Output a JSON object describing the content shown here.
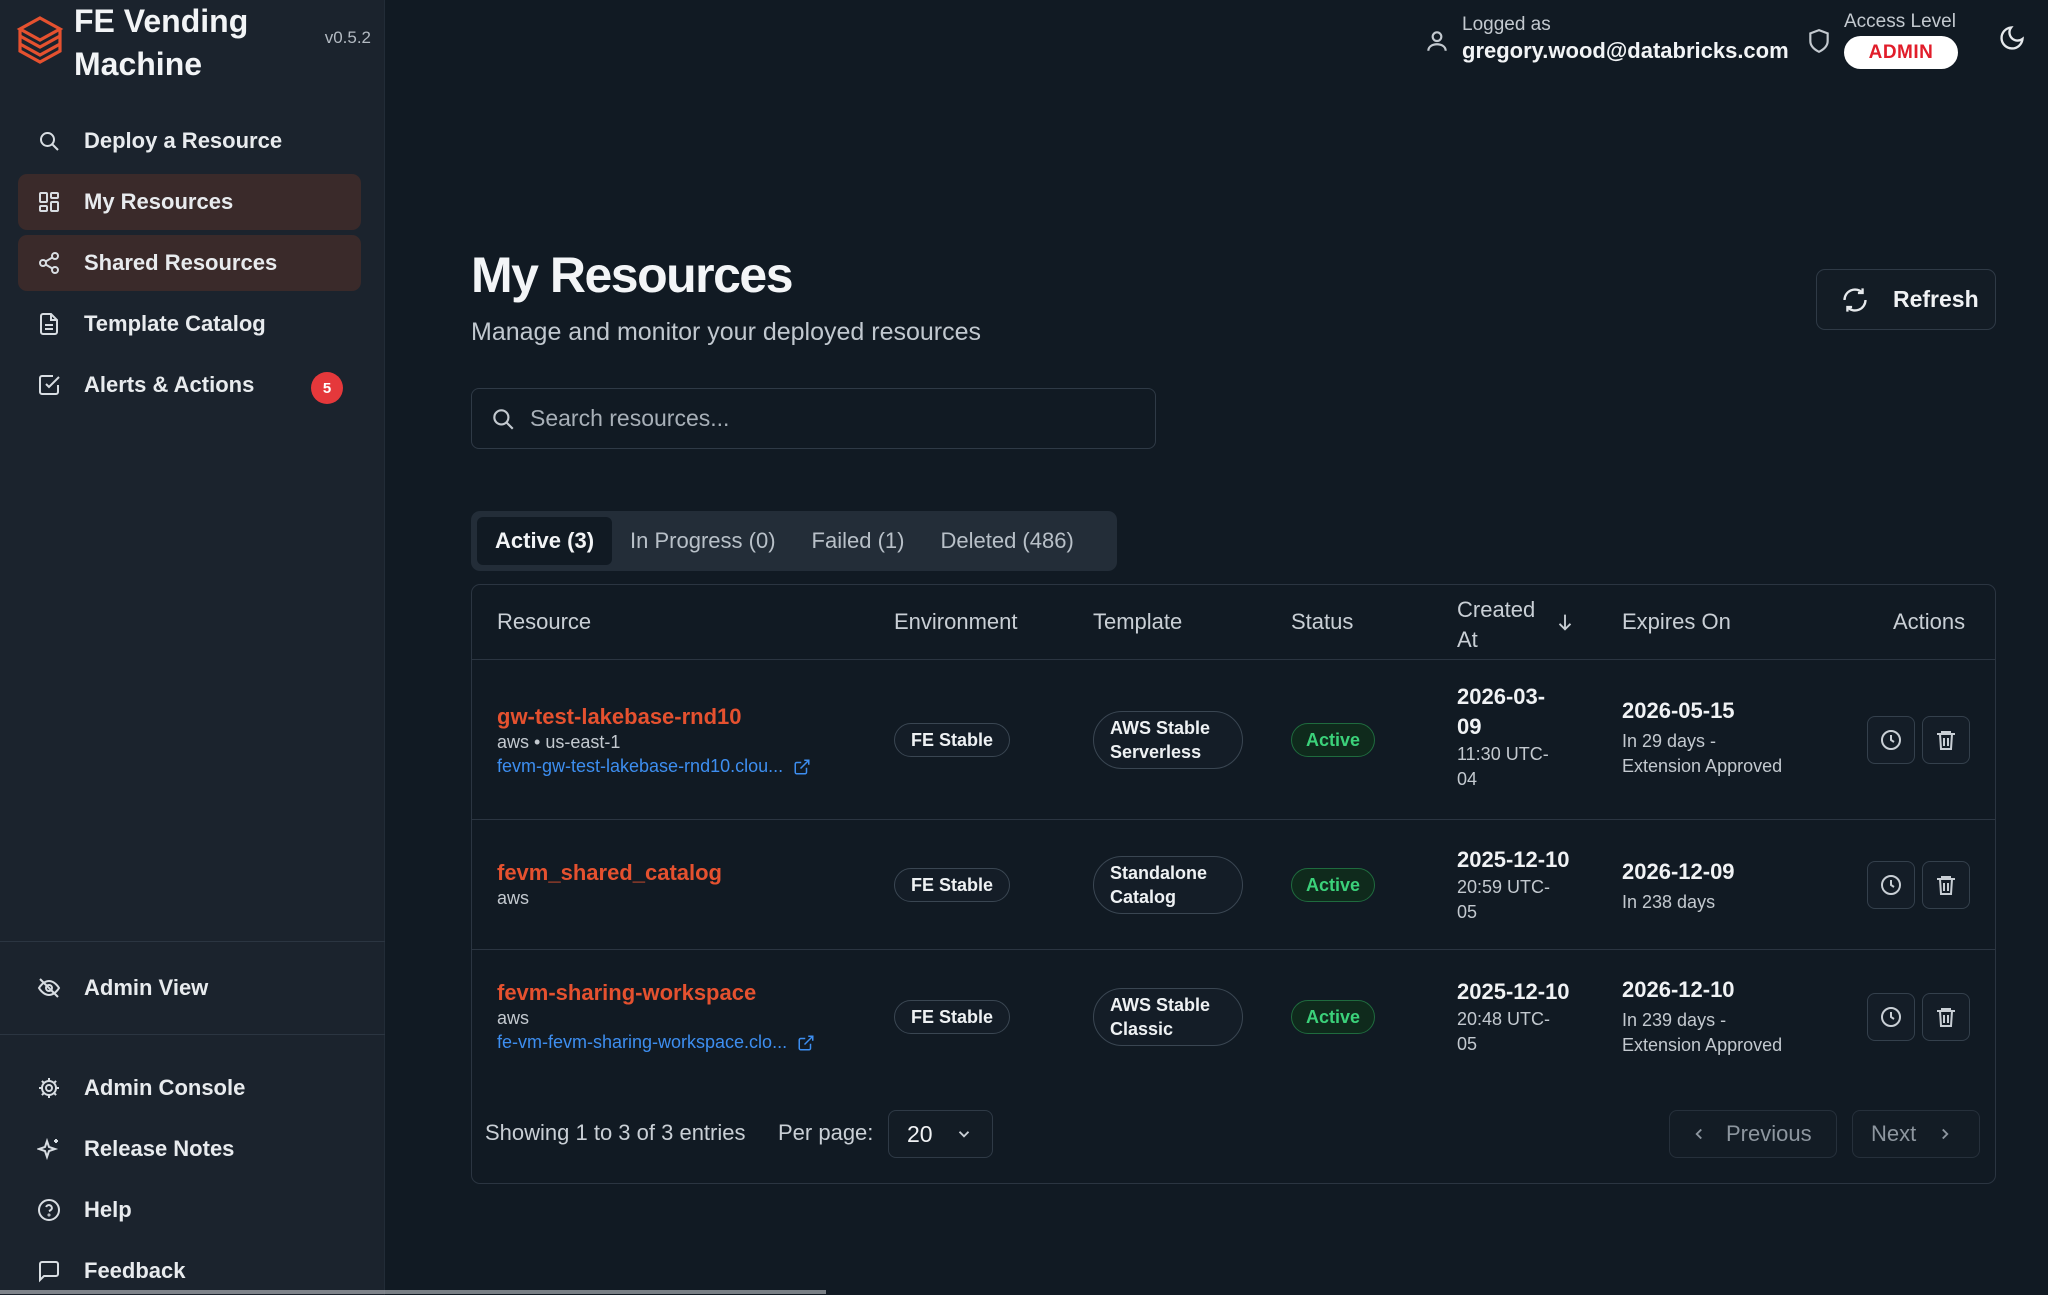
{
  "app": {
    "name": "FE Vending Machine",
    "version": "v0.5.2"
  },
  "sidebar": {
    "items": [
      {
        "label": "Deploy a Resource",
        "icon": "search-icon"
      },
      {
        "label": "My Resources",
        "icon": "grid-icon"
      },
      {
        "label": "Shared Resources",
        "icon": "share-icon"
      },
      {
        "label": "Template Catalog",
        "icon": "document-icon"
      },
      {
        "label": "Alerts & Actions",
        "icon": "checkbox-icon",
        "badge": "5"
      }
    ],
    "admin_view": {
      "label": "Admin View",
      "icon": "eye-off-icon"
    },
    "bottom_items": [
      {
        "label": "Admin Console",
        "icon": "gear-icon"
      },
      {
        "label": "Release Notes",
        "icon": "sparkles-icon"
      },
      {
        "label": "Help",
        "icon": "help-circle-icon"
      },
      {
        "label": "Feedback",
        "icon": "message-icon"
      }
    ]
  },
  "header": {
    "logged_as_label": "Logged as",
    "user_email": "gregory.wood@databricks.com",
    "access_label": "Access Level",
    "access_value": "ADMIN"
  },
  "main": {
    "title": "My Resources",
    "subtitle": "Manage and monitor your deployed resources",
    "refresh_label": "Refresh",
    "search_placeholder": "Search resources...",
    "tabs": [
      {
        "label": "Active (3)",
        "active": true
      },
      {
        "label": "In Progress (0)",
        "active": false
      },
      {
        "label": "Failed (1)",
        "active": false
      },
      {
        "label": "Deleted (486)",
        "active": false
      }
    ]
  },
  "table": {
    "columns": {
      "resource": "Resource",
      "environment": "Environment",
      "template": "Template",
      "status": "Status",
      "created_at": "Created At",
      "expires_on": "Expires On",
      "actions": "Actions"
    },
    "rows": [
      {
        "name": "gw-test-lakebase-rnd10",
        "cloud": "aws • us-east-1",
        "link": "fevm-gw-test-lakebase-rnd10.clou...",
        "environment": "FE Stable",
        "template_line1": "AWS Stable",
        "template_line2": "Serverless",
        "status": "Active",
        "created_date_1": "2026-03-",
        "created_date_2": "09",
        "created_time_1": "11:30 UTC-",
        "created_time_2": "04",
        "expires_date": "2026-05-15",
        "expires_note_1": "In 29 days -",
        "expires_note_2": "Extension Approved"
      },
      {
        "name": "fevm_shared_catalog",
        "cloud": "aws",
        "environment": "FE Stable",
        "template_line1": "Standalone",
        "template_line2": "Catalog",
        "status": "Active",
        "created_date_1": "2025-12-10",
        "created_time_1": "20:59 UTC-",
        "created_time_2": "05",
        "expires_date": "2026-12-09",
        "expires_note_1": "In 238 days"
      },
      {
        "name": "fevm-sharing-workspace",
        "cloud": "aws",
        "link": "fe-vm-fevm-sharing-workspace.clo...",
        "environment": "FE Stable",
        "template_line1": "AWS Stable",
        "template_line2": "Classic",
        "status": "Active",
        "created_date_1": "2025-12-10",
        "created_time_1": "20:48 UTC-",
        "created_time_2": "05",
        "expires_date": "2026-12-10",
        "expires_note_1": "In 239 days -",
        "expires_note_2": "Extension Approved"
      }
    ],
    "footer": {
      "showing": "Showing 1 to 3 of 3 entries",
      "per_page_label": "Per page:",
      "per_page_value": "20",
      "previous": "Previous",
      "next": "Next"
    }
  },
  "colors": {
    "accent": "#e5512f",
    "link": "#3d8ef0",
    "status_active": "#3bd17a",
    "badge": "#e5383b"
  }
}
